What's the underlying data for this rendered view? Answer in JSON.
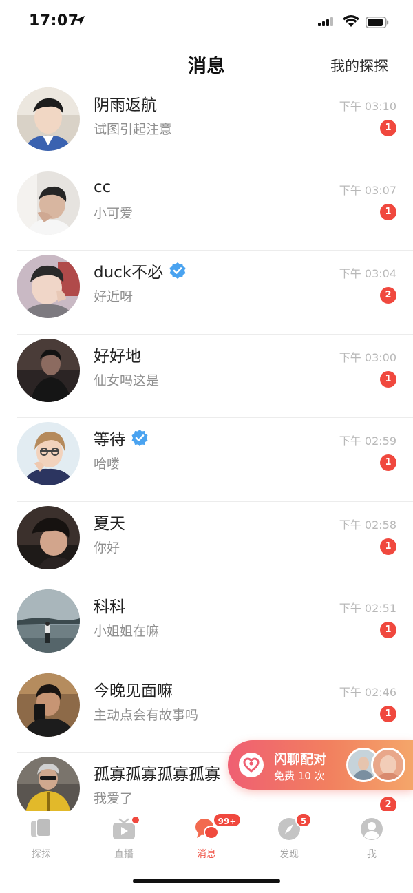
{
  "status_bar": {
    "time": "17:07"
  },
  "header": {
    "title": "消息",
    "right_link": "我的探探"
  },
  "messages": [
    {
      "name": "阴雨返航",
      "verified": false,
      "preview": "试图引起注意",
      "time": "下午 03:10",
      "unread": "1"
    },
    {
      "name": "cc",
      "verified": false,
      "preview": "小可爱",
      "time": "下午 03:07",
      "unread": "1"
    },
    {
      "name": "duck不必",
      "verified": true,
      "preview": "好近呀",
      "time": "下午 03:04",
      "unread": "2"
    },
    {
      "name": "好好地",
      "verified": false,
      "preview": "仙女吗这是",
      "time": "下午 03:00",
      "unread": "1"
    },
    {
      "name": "等待",
      "verified": true,
      "preview": "哈喽",
      "time": "下午 02:59",
      "unread": "1"
    },
    {
      "name": "夏天",
      "verified": false,
      "preview": "你好",
      "time": "下午 02:58",
      "unread": "1"
    },
    {
      "name": "科科",
      "verified": false,
      "preview": "小姐姐在嘛",
      "time": "下午 02:51",
      "unread": "1"
    },
    {
      "name": "今晚见面嘛",
      "verified": false,
      "preview": "主动点会有故事吗",
      "time": "下午 02:46",
      "unread": "1"
    },
    {
      "name": "孤寡孤寡孤寡孤寡",
      "verified": false,
      "preview": "我爱了",
      "time": "",
      "unread": "2"
    }
  ],
  "flash_chat": {
    "title": "闪聊配对",
    "subtitle": "免费 10 次"
  },
  "tabbar": {
    "tabs": [
      {
        "label": "探探",
        "icon": "cards-icon"
      },
      {
        "label": "直播",
        "icon": "live-tv-icon"
      },
      {
        "label": "消息",
        "icon": "chat-bubbles-icon",
        "badge": "99+"
      },
      {
        "label": "发现",
        "icon": "compass-icon",
        "badge": "5"
      },
      {
        "label": "我",
        "icon": "profile-icon"
      }
    ]
  },
  "colors": {
    "accent": "#f0594c",
    "badge": "#f0483e",
    "verified": "#4aa3f0"
  }
}
